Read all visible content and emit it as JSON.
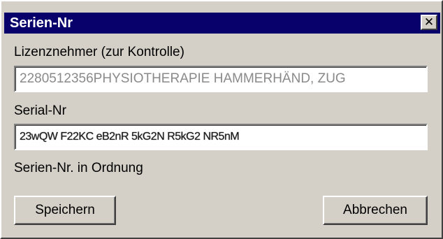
{
  "window": {
    "title": "Serien-Nr",
    "close_glyph": "✕"
  },
  "licensee": {
    "label": "Lizenznehmer (zur Kontrolle)",
    "value": "2280512356PHYSIOTHERAPIE HAMMERHÄND, ZUG"
  },
  "serial": {
    "label": "Serial-Nr",
    "value": "23wQW F22KC eB2nR 5kG2N R5kG2 NR5nM"
  },
  "status": {
    "text": "Serien-Nr. in Ordnung"
  },
  "buttons": {
    "save_label": "Speichern",
    "cancel_label": "Abbrechen"
  },
  "colors": {
    "titlebar": "#08006b",
    "face": "#d4d0c8",
    "readonly_text": "#8a8a8a"
  }
}
